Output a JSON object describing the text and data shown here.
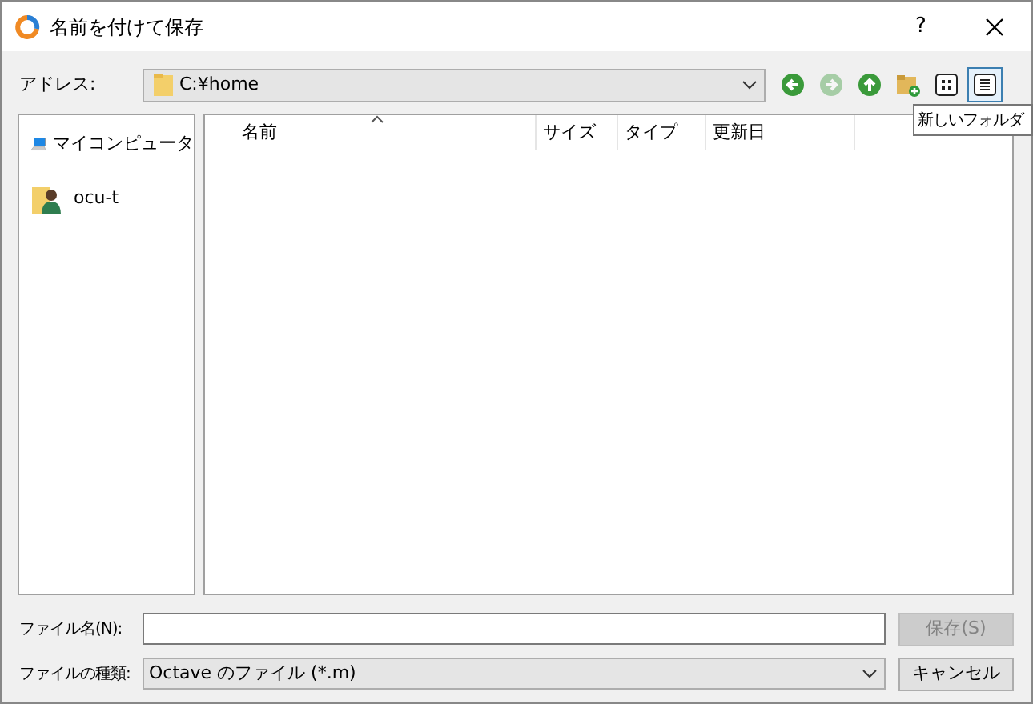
{
  "window": {
    "title": "名前を付けて保存",
    "help": "?"
  },
  "address": {
    "label": "アドレス:",
    "value": "C:¥home"
  },
  "toolbar": [
    {
      "kind": "back",
      "disabled": false,
      "selected": false
    },
    {
      "kind": "forward",
      "disabled": true,
      "selected": false
    },
    {
      "kind": "up",
      "disabled": false,
      "selected": false
    },
    {
      "kind": "newfolder",
      "disabled": false,
      "selected": false
    },
    {
      "kind": "icons",
      "disabled": false,
      "selected": false
    },
    {
      "kind": "details",
      "disabled": false,
      "selected": true
    }
  ],
  "tooltip": "新しいフォルダ",
  "sidebar": {
    "items": [
      {
        "kind": "computer",
        "label": "マイコンピュータ"
      },
      {
        "kind": "user",
        "label": "ocu-t"
      }
    ]
  },
  "table": {
    "columns": [
      {
        "label": "名前",
        "sorted": true
      },
      {
        "label": "サイズ",
        "sorted": false
      },
      {
        "label": "タイプ",
        "sorted": false
      },
      {
        "label": "更新日",
        "sorted": false
      }
    ]
  },
  "filename": {
    "label": "ファイル名(N):"
  },
  "filetype": {
    "label": "ファイルの種類:",
    "value": "Octave のファイル (*.m)"
  },
  "buttons": [
    {
      "label": "保存(S)",
      "disabled": true
    },
    {
      "label": "キャンセル",
      "disabled": false
    }
  ]
}
